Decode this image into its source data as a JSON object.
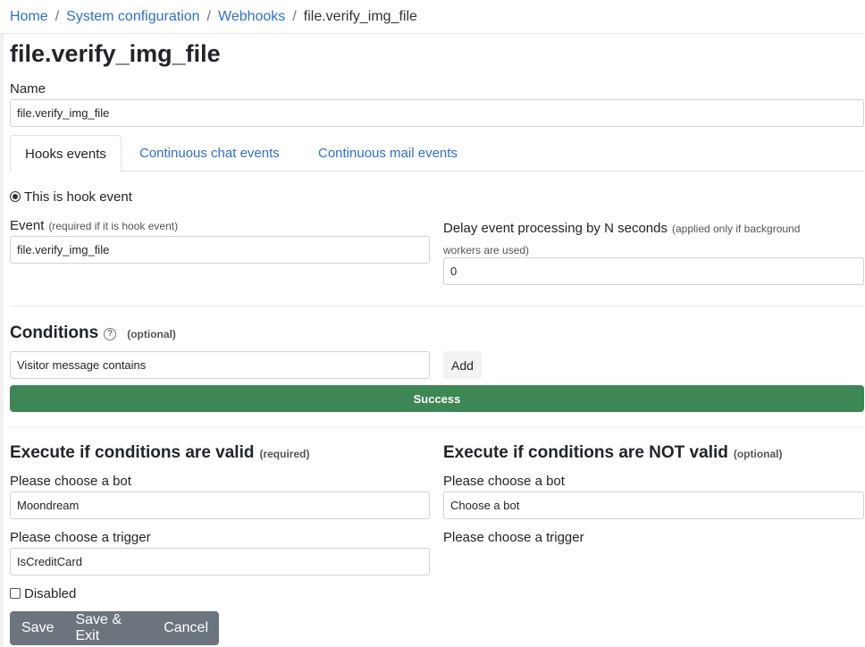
{
  "breadcrumb": {
    "home": "Home",
    "system_configuration": "System configuration",
    "webhooks": "Webhooks",
    "current": "file.verify_img_file",
    "separator": "/"
  },
  "page_title": "file.verify_img_file",
  "name_field": {
    "label": "Name",
    "value": "file.verify_img_file"
  },
  "tabs": [
    {
      "label": "Hooks events",
      "active": true
    },
    {
      "label": "Continuous chat events",
      "active": false
    },
    {
      "label": "Continuous mail events",
      "active": false
    }
  ],
  "hook_event_radio": {
    "label": "This is hook event",
    "checked": true
  },
  "event_field": {
    "label": "Event",
    "hint": "(required if it is hook event)",
    "value": "file.verify_img_file"
  },
  "delay_field": {
    "label": "Delay event processing by N seconds",
    "hint_line1": "(applied only if background",
    "hint_line2": "workers are used)",
    "value": "0"
  },
  "conditions": {
    "title": "Conditions",
    "help_icon": "question-circle-icon",
    "help_glyph": "?",
    "optional_label": "(optional)",
    "select_value": "Visitor message contains",
    "add_button": "Add",
    "status_text": "Success",
    "status_color": "#3d8754"
  },
  "execute_valid": {
    "title": "Execute if conditions are valid",
    "note": "(required)",
    "bot_label": "Please choose a bot",
    "bot_value": "Moondream",
    "trigger_label": "Please choose a trigger",
    "trigger_value": "IsCreditCard"
  },
  "execute_invalid": {
    "title": "Execute if conditions are NOT valid",
    "note": "(optional)",
    "bot_label": "Please choose a bot",
    "bot_value": "Choose a bot",
    "trigger_label": "Please choose a trigger"
  },
  "disabled_checkbox": {
    "label": "Disabled",
    "checked": false
  },
  "actions": {
    "save": "Save",
    "save_exit": "Save & Exit",
    "cancel": "Cancel"
  },
  "colors": {
    "link": "#2f6fcf",
    "button_group": "#6c757d"
  }
}
